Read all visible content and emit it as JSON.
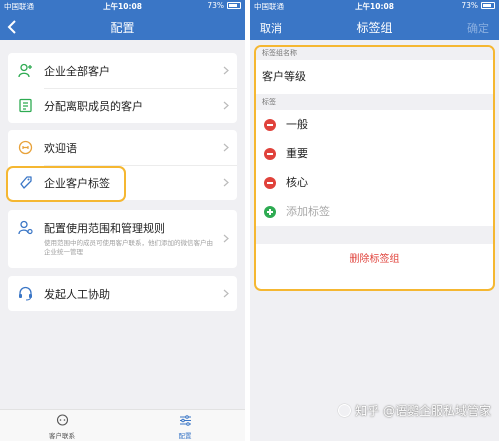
{
  "left": {
    "status": {
      "carrier": "中国联通",
      "time": "上午10:08",
      "battery": "73%"
    },
    "nav": {
      "title": "配置"
    },
    "menu_group1": [
      {
        "label": "企业全部客户"
      },
      {
        "label": "分配离职成员的客户"
      }
    ],
    "menu_group2": [
      {
        "label": "欢迎语"
      },
      {
        "label": "企业客户标签"
      }
    ],
    "menu_group3": {
      "title": "配置使用范围和管理规则",
      "desc": "使用范围中的成员可使用客户联系，他们添加的微信客户由企业统一管理"
    },
    "menu_group4": {
      "label": "发起人工协助"
    },
    "tabs": [
      {
        "label": "客户联系"
      },
      {
        "label": "配置"
      }
    ]
  },
  "right": {
    "status": {
      "carrier": "中国联通",
      "time": "上午10:08",
      "battery": "73%"
    },
    "nav": {
      "cancel": "取消",
      "title": "标签组",
      "confirm": "确定"
    },
    "group_name_header": "标签组名称",
    "group_name": "客户等级",
    "tags_header": "标签",
    "tags": [
      "一般",
      "重要",
      "核心"
    ],
    "add_tag": "添加标签",
    "delete_group": "删除标签组"
  },
  "watermark": "知乎 @语鹦企服私域管家",
  "colors": {
    "brand_blue": "#3a76c6",
    "highlight": "#f5b731",
    "delete_red": "#e0423b",
    "add_green": "#2eab52"
  }
}
